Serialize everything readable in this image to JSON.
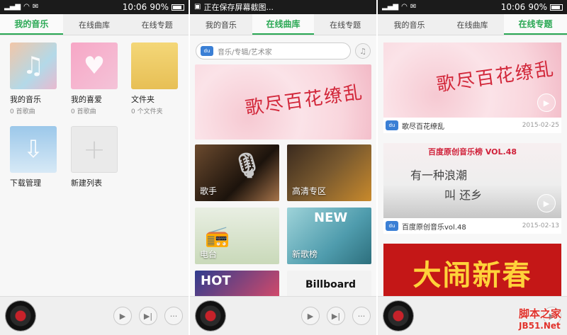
{
  "panels": [
    {
      "status": {
        "time": "10:06",
        "battery": "90%"
      },
      "tabs": [
        "我的音乐",
        "在线曲库",
        "在线专题"
      ],
      "active_tab": 0,
      "tiles": [
        {
          "title": "我的音乐",
          "sub": "0 首歌曲",
          "icon": "music-note-icon"
        },
        {
          "title": "我的喜爱",
          "sub": "0 首歌曲",
          "icon": "heart-icon"
        },
        {
          "title": "文件夹",
          "sub": "0 个文件夹",
          "icon": "folder-icon"
        },
        {
          "title": "下载管理",
          "sub": "",
          "icon": "download-icon"
        },
        {
          "title": "新建列表",
          "sub": "",
          "icon": "plus-icon"
        }
      ]
    },
    {
      "status": {
        "text": "正在保存屏幕截图..."
      },
      "tabs": [
        "我的音乐",
        "在线曲库",
        "在线专题"
      ],
      "active_tab": 1,
      "search_placeholder": "音乐/专辑/艺术家",
      "baidu_badge": "百度音乐",
      "banner_text": "歌尽百花缭乱",
      "categories": [
        "歌手",
        "高清专区",
        "电台",
        "新歌榜",
        "HOT",
        "Billboard"
      ]
    },
    {
      "status": {
        "time": "10:06",
        "battery": "90%"
      },
      "tabs": [
        "我的音乐",
        "在线曲库",
        "在线专题"
      ],
      "active_tab": 2,
      "topics": [
        {
          "title": "歌尽百花缭乱",
          "date": "2015-02-25"
        },
        {
          "title": "百度原创音乐vol.48",
          "date": "2015-02-13"
        },
        {
          "title": "大闹新春",
          "date": ""
        }
      ],
      "vol_banner": {
        "header": "百度原创音乐榜 VOL.48",
        "line1": "有一种浪潮",
        "line2": "叫 还乡"
      }
    }
  ],
  "player": {
    "play": "▶",
    "next": "▶|",
    "more": "···"
  },
  "watermark": {
    "line1": "脚本之家",
    "line2": "JB51.Net"
  }
}
